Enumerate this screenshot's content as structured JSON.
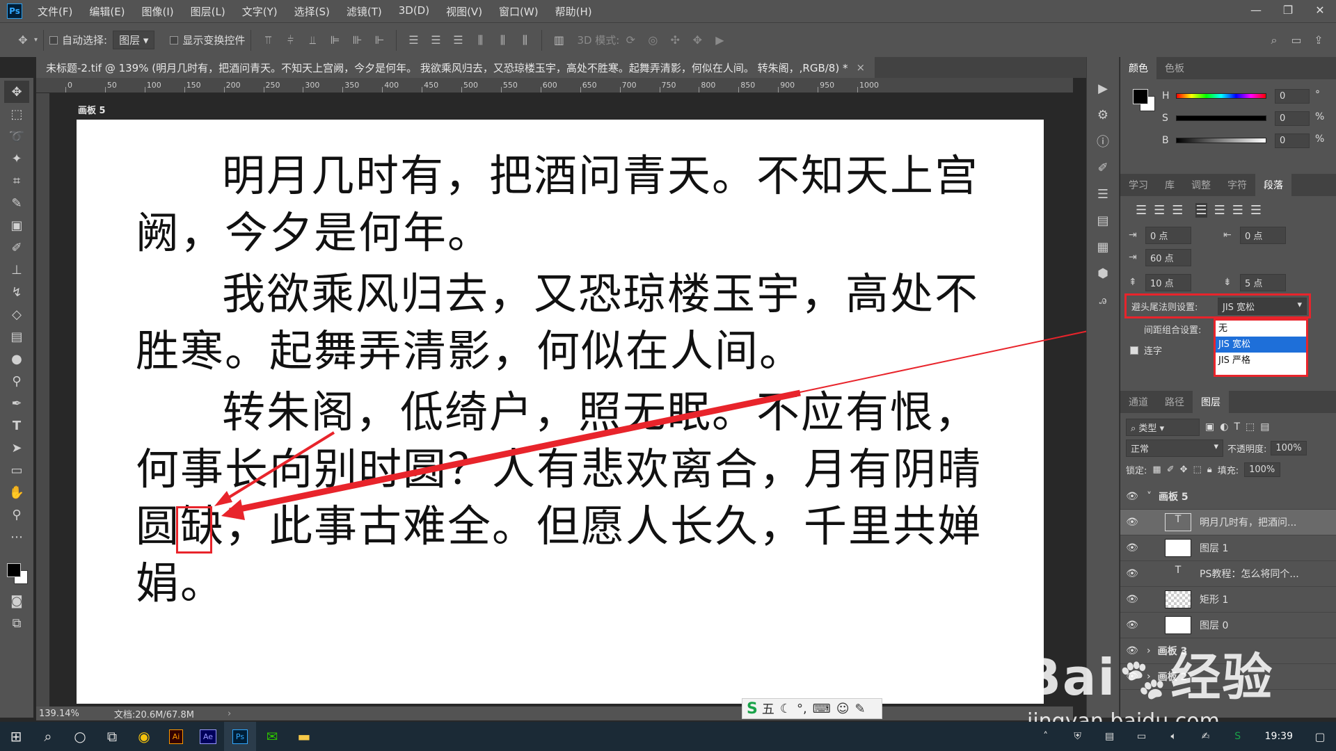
{
  "app": {
    "logo": "Ps"
  },
  "menu": [
    "文件(F)",
    "编辑(E)",
    "图像(I)",
    "图层(L)",
    "文字(Y)",
    "选择(S)",
    "滤镜(T)",
    "3D(D)",
    "视图(V)",
    "窗口(W)",
    "帮助(H)"
  ],
  "options": {
    "auto_select_label": "自动选择:",
    "auto_select_value": "图层",
    "show_transform_label": "显示变换控件",
    "mode_3d_label": "3D 模式:"
  },
  "doc_tab": {
    "title": "未标题-2.tif @ 139% (明月几时有，把酒问青天。不知天上宫阙，今夕是何年。 我欲乘风归去，又恐琼楼玉宇，高处不胜寒。起舞弄清影，何似在人间。 转朱阁，,RGB/8) *",
    "close": "×"
  },
  "ruler_labels": [
    "0",
    "50",
    "100",
    "150",
    "200",
    "250",
    "300",
    "350",
    "400",
    "450",
    "500",
    "550",
    "600",
    "650",
    "700",
    "750",
    "800",
    "850",
    "900",
    "950",
    "1000"
  ],
  "artboard_label": "画板 5",
  "document": {
    "paragraphs": [
      "明月几时有，把酒问青天。不知天上宫阙，今夕是何年。",
      "我欲乘风归去，又恐琼楼玉宇，高处不胜寒。起舞弄清影，何似在人间。",
      "转朱阁，低绮户，照无眠。不应有恨，何事长向别时圆？人有悲欢离合，月有阴晴圆缺，此事古难全。但愿人长久，千里共婵娟。"
    ]
  },
  "status": {
    "zoom": "139.14%",
    "doc_size": "文档:20.6M/67.8M"
  },
  "color_panel": {
    "tabs": [
      "颜色",
      "色板"
    ],
    "h_label": "H",
    "h_value": "0",
    "h_unit": "°",
    "s_label": "S",
    "s_value": "0",
    "s_unit": "%",
    "b_label": "B",
    "b_value": "0",
    "b_unit": "%"
  },
  "paragraph_panel": {
    "tabs": [
      "学习",
      "库",
      "调整",
      "字符",
      "段落"
    ],
    "indent_left": "0 点",
    "indent_right": "0 点",
    "indent_first": "60 点",
    "space_before": "10 点",
    "space_after": "5 点",
    "kinsoku_label": "避头尾法则设置:",
    "kinsoku_value": "JIS 宽松",
    "spacing_label": "间距组合设置:",
    "hyphen_label": "连字",
    "dropdown_options": [
      "无",
      "JIS 宽松",
      "JIS 严格"
    ],
    "selected_index": 1
  },
  "layers_panel": {
    "tabs": [
      "通道",
      "路径",
      "图层"
    ],
    "filter_label": "类型",
    "blend_mode": "正常",
    "opacity_label": "不透明度:",
    "opacity_value": "100%",
    "lock_label": "锁定:",
    "fill_label": "填充:",
    "fill_value": "100%",
    "layers": [
      {
        "name": "画板 5",
        "type": "group"
      },
      {
        "name": "明月几时有，把酒问...",
        "type": "text"
      },
      {
        "name": "图层 1",
        "type": "pixel"
      },
      {
        "name": "PS教程：怎么将同个...",
        "type": "text"
      },
      {
        "name": "矩形 1",
        "type": "shape"
      },
      {
        "name": "图层 0",
        "type": "pixel"
      },
      {
        "name": "画板 3",
        "type": "group"
      },
      {
        "name": "画板 2",
        "type": "group"
      }
    ]
  },
  "ime": {
    "label": "五"
  },
  "watermark": {
    "brand": "Bai",
    "brand2": "经验",
    "url": "jingyan.baidu.com"
  },
  "taskbar": {
    "time": "19:39"
  },
  "colors": {
    "accent_red": "#e8242b",
    "selection_blue": "#1e6fd9"
  }
}
